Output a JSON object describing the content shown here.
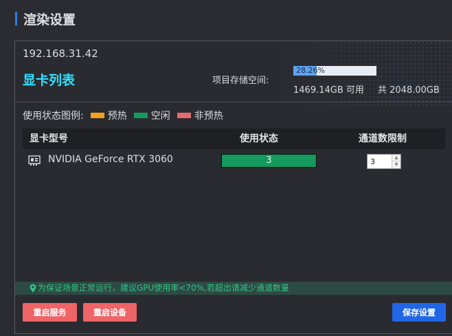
{
  "header": {
    "title": "渲染设置"
  },
  "panel": {
    "ip": "192.168.31.42",
    "section_title": "显卡列表",
    "storage": {
      "label": "项目存储空间:",
      "percent": 28.26,
      "percent_text": "28.26%",
      "free_text": "1469.14GB 可用",
      "total_text": "共 2048.00GB"
    },
    "legend": {
      "label": "使用状态图例:",
      "items": [
        {
          "label": "预热",
          "color": "#f5a01a"
        },
        {
          "label": "空闲",
          "color": "#139a5c"
        },
        {
          "label": "非预热",
          "color": "#e36a6e"
        }
      ]
    },
    "table": {
      "columns": [
        "显卡型号",
        "使用状态",
        "通道数限制"
      ],
      "rows": [
        {
          "model": "NVIDIA GeForce RTX 3060",
          "status": "3",
          "status_color": "#139a5c",
          "channel_limit": "3"
        }
      ]
    },
    "hint": "为保证场景正常运行，建议GPU使用率<70%,若超出请减少通道数量",
    "buttons": {
      "restart_service": "重启服务",
      "restart_device": "重启设备",
      "save": "保存设置"
    }
  }
}
